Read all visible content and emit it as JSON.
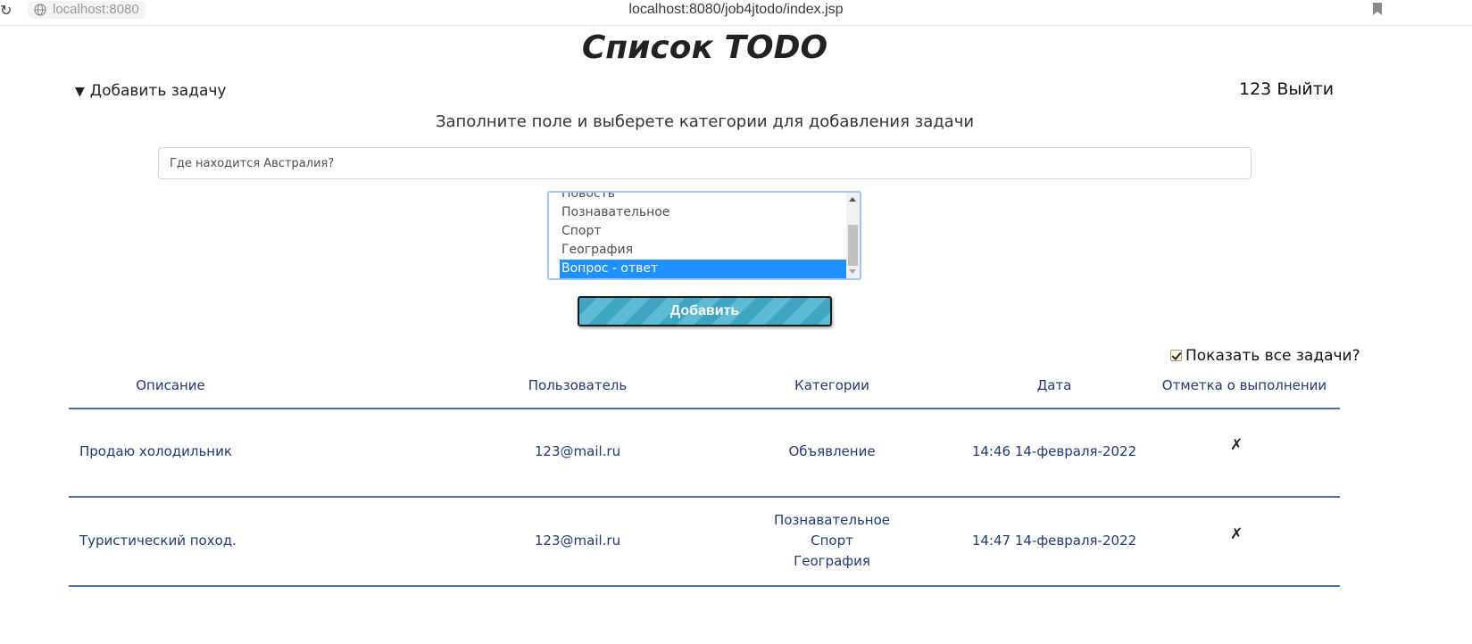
{
  "browser": {
    "reload_icon": "reload-icon",
    "host_chip": "localhost:8080",
    "url": "localhost:8080/job4jtodo/index.jsp"
  },
  "page": {
    "title": "Список TODO"
  },
  "add_task": {
    "summary_label": "Добавить задачу",
    "hint": "Заполните поле и выберете категории для добавления задачи",
    "description_value": "Где находится Австралия?",
    "categories": [
      {
        "label": "Новость"
      },
      {
        "label": "Познавательное"
      },
      {
        "label": "Спорт"
      },
      {
        "label": "География"
      },
      {
        "label": "Вопрос - ответ"
      }
    ],
    "selected_category": "Вопрос - ответ",
    "submit_label": "Добавить"
  },
  "user": {
    "name": "123",
    "logout_label": "Выйти"
  },
  "filter": {
    "show_all_label": "Показать все задачи?",
    "show_all_checked": true
  },
  "table": {
    "headers": [
      "Описание",
      "Пользователь",
      "Категории",
      "Дата",
      "Отметка о выполнении"
    ],
    "rows": [
      {
        "description": "Продаю холодильник",
        "user": "123@mail.ru",
        "categories": [
          "Объявление"
        ],
        "date": "14:46 14-февраля-2022",
        "done_mark": "✗"
      },
      {
        "description": "Туристический поход.",
        "user": "123@mail.ru",
        "categories": [
          "Познавательное",
          "Спорт",
          "География"
        ],
        "date": "14:47 14-февраля-2022",
        "done_mark": "✗"
      }
    ]
  },
  "colors": {
    "accent_blue": "#1f3a79",
    "divider": "#4a6cb0",
    "selection": "#1e90ff",
    "button": "#3ea6c2"
  }
}
